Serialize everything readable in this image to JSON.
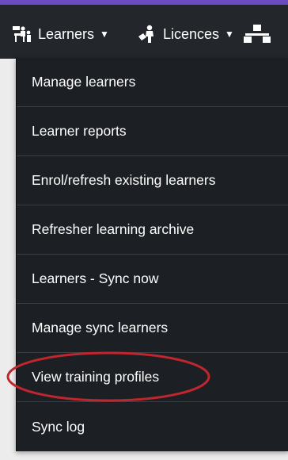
{
  "navbar": {
    "items": [
      {
        "label": "Learners",
        "icon": "learners-classroom-icon",
        "has_dropdown": true
      },
      {
        "label": "Licences",
        "icon": "licence-person-icon",
        "has_dropdown": true
      },
      {
        "label": "",
        "icon": "organisation-hierarchy-icon",
        "has_dropdown": false
      }
    ],
    "accent_color": "#6b4bc0",
    "background_color": "#23262b"
  },
  "learners_menu": {
    "items": [
      {
        "label": "Manage learners"
      },
      {
        "label": "Learner reports"
      },
      {
        "label": "Enrol/refresh existing learners"
      },
      {
        "label": "Refresher learning archive"
      },
      {
        "label": "Learners - Sync now"
      },
      {
        "label": "Manage sync learners"
      },
      {
        "label": "View training profiles",
        "highlighted": true
      },
      {
        "label": "Sync log"
      }
    ],
    "background_color": "#1c1f24",
    "highlight_color": "#c0262d"
  }
}
